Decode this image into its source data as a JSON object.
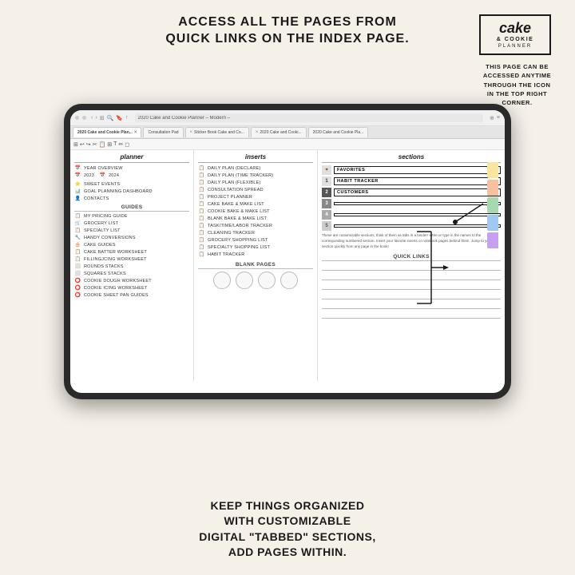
{
  "header": {
    "title_line1": "ACCESS ALL THE PAGES FROM",
    "title_line2": "QUICK LINKS ON THE INDEX PAGE.",
    "brand": {
      "name": "cake",
      "sub": "& COOKIE",
      "planner": "PLANNER"
    }
  },
  "side_note": {
    "text": "THIS PAGE CAN BE\nACCESSED ANYTIME\nTHROUGH THE ICON\nIN THE TOP RIGHT CORNER."
  },
  "tablet": {
    "address_bar": "2020 Cake and Cookie Planner – Modern –",
    "tabs": [
      {
        "label": "2020 Cake and Cookie Plan...",
        "active": true
      },
      {
        "label": "Consultation Pad"
      },
      {
        "label": "Sticker Book Cake and Co..."
      },
      {
        "label": "2020 Cake and Cooki..."
      },
      {
        "label": "2020 Cake and Cookie Pla..."
      }
    ],
    "planner_col": {
      "header": "planner",
      "items": [
        {
          "icon": "📅",
          "text": "YEAR OVERVIEW"
        },
        {
          "icon": "📅",
          "text": "2023"
        },
        {
          "icon": "📅",
          "text": "2024"
        },
        {
          "icon": "⭐",
          "text": "SWEET EVENTS"
        },
        {
          "icon": "📊",
          "text": "GOAL PLANNING DASHBOARD"
        },
        {
          "icon": "👤",
          "text": "CONTACTS"
        }
      ],
      "guides_label": "guides",
      "guides": [
        {
          "icon": "📋",
          "text": "MY PRICING GUIDE"
        },
        {
          "icon": "🛒",
          "text": "GROCERY LIST"
        },
        {
          "icon": "📋",
          "text": "SPECIALTY LIST"
        },
        {
          "icon": "🔧",
          "text": "HANDY CONVERSIONS"
        },
        {
          "icon": "🎂",
          "text": "CAKE GUIDES"
        },
        {
          "icon": "📋",
          "text": "CAKE BATTER WORKSHEET"
        },
        {
          "icon": "📋",
          "text": "FILLINGJCING WORKSHEET"
        },
        {
          "icon": "⬜",
          "text": "ROUNDS STACKS"
        },
        {
          "icon": "⬜",
          "text": "SQUARES STACKS"
        },
        {
          "icon": "⭕",
          "text": "COOKIE DOUGH WORKSHEET"
        },
        {
          "icon": "⭕",
          "text": "COOKIE ICING WORKSHEET"
        },
        {
          "icon": "⭕",
          "text": "COOKIE SHEET PAN GUIDES"
        }
      ]
    },
    "inserts_col": {
      "header": "inserts",
      "items": [
        {
          "text": "DAILY PLAN (DECLARE)"
        },
        {
          "text": "DAILY PLAN (TIME TRACKER)"
        },
        {
          "text": "DAILY PLAN (FLEXIBLE)"
        },
        {
          "text": "CONSULTATION SPREAD"
        },
        {
          "text": "PROJECT PLANNER"
        },
        {
          "text": "CAKE BAKE & MAKE LIST"
        },
        {
          "text": "COOKIE BAKE & MAKE LIST"
        },
        {
          "text": "BLANK BAKE & MAKE LIST"
        },
        {
          "text": "TASK/TIME/LABOR TRACKER"
        },
        {
          "text": "CLEANING TRACKER"
        },
        {
          "text": "GROCERY SHOPPING LIST"
        },
        {
          "text": "SPECIALTY SHOPPING LIST"
        },
        {
          "text": "HABIT TRACKER"
        }
      ],
      "blank_pages": {
        "label": "blank pages",
        "circles": 4
      }
    },
    "sections_col": {
      "header": "sections",
      "rows": [
        {
          "num": "♥",
          "name": "FAVORITES",
          "heart": true
        },
        {
          "num": "1",
          "name": "HABIT TRACKER"
        },
        {
          "num": "2",
          "name": "CUSTOMERS"
        },
        {
          "num": "3",
          "name": ""
        },
        {
          "num": "4",
          "name": ""
        },
        {
          "num": "5",
          "name": ""
        }
      ],
      "desc": "These are customizable sections, think of them as tabs in a binder! Write or type in the names to the corresponding numbered section. Insert your favorite inserts or notebook pages behind them. Jump to your section quickly from any page in the book!",
      "quick_links_label": "quick links",
      "quick_links_count": 6
    }
  },
  "footer": {
    "text_line1": "KEEP THINGS ORGANIZED",
    "text_line2": "WITH CUSTOMIZABLE",
    "text_line3": "DIGITAL \"TABBED\" SECTIONS,",
    "text_line4": "ADD PAGES WITHIN."
  }
}
